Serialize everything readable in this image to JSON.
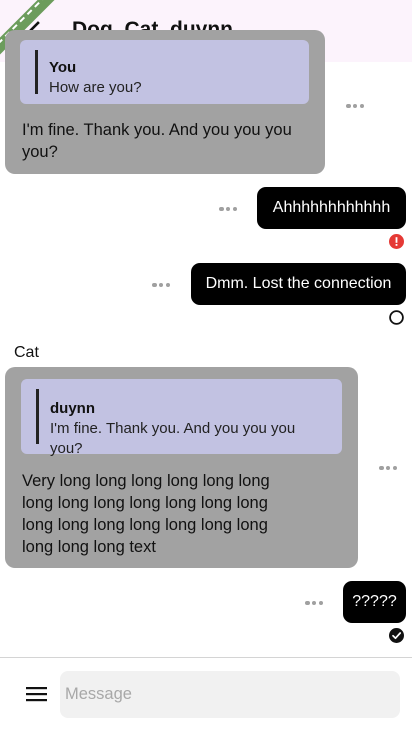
{
  "header": {
    "title": "Dog, Cat, duynn"
  },
  "messages": [
    {
      "direction": "incoming",
      "reply_to": {
        "name": "You",
        "text": "How are you?"
      },
      "text_lines": [
        "I'm fine. Thank you. And you you you",
        "you?"
      ]
    },
    {
      "direction": "outgoing",
      "text": "Ahhhhhhhhhhhh",
      "status": "error"
    },
    {
      "direction": "outgoing",
      "text": "Dmm. Lost the connection",
      "status": "sending"
    },
    {
      "direction": "incoming",
      "sender": "Cat",
      "reply_to": {
        "name": "duynn",
        "text_lines": [
          "I'm fine. Thank you. And you you you",
          "you?"
        ]
      },
      "text_lines": [
        "Very long long long long long long",
        "long long long long long long long",
        "long long long long long long long",
        "long long long text"
      ]
    },
    {
      "direction": "outgoing",
      "text": "?????",
      "status": "delivered"
    }
  ],
  "composer": {
    "placeholder": "Message",
    "value": ""
  },
  "colors": {
    "header_bg": "#fcf3fc",
    "incoming_bubble": "#a2a2a2",
    "quote_bg": "#c2c2e2",
    "outgoing_bubble": "#000000",
    "error": "#e53935"
  },
  "icons": {
    "back": "chevron-left-icon",
    "more": "more-horizontal-icon",
    "error": "error-icon",
    "sending": "circle-outline-icon",
    "delivered": "check-circle-icon",
    "menu": "hamburger-menu-icon"
  }
}
